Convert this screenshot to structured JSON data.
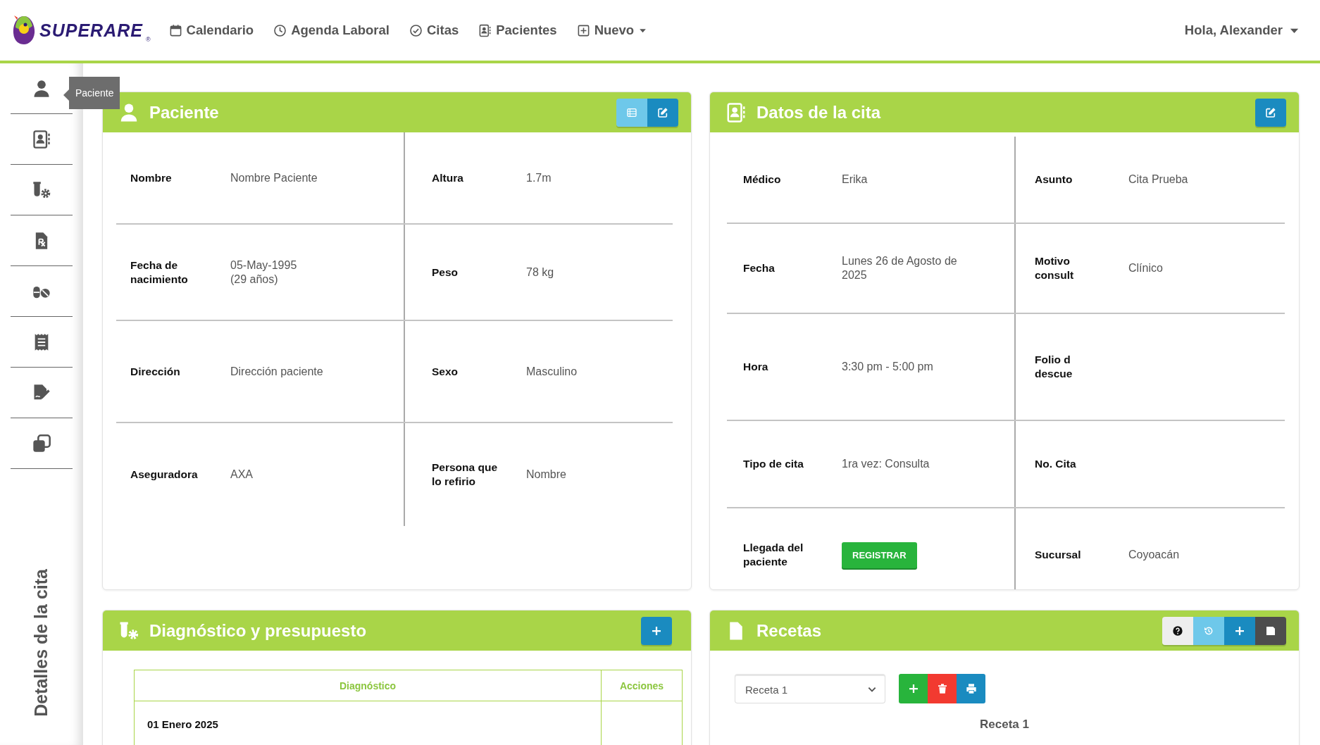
{
  "topbar": {
    "brand": "SUPERARE",
    "brand_mark": "®",
    "nav": [
      {
        "label": "Calendario",
        "dropdown": false
      },
      {
        "label": "Agenda Laboral",
        "dropdown": false
      },
      {
        "label": "Citas",
        "dropdown": false
      },
      {
        "label": "Pacientes",
        "dropdown": false
      },
      {
        "label": "Nuevo",
        "dropdown": true
      }
    ],
    "user": "Hola, Alexander"
  },
  "sidebar": {
    "tooltip": "Paciente",
    "title": "Detalles de la cita"
  },
  "patient": {
    "title": "Paciente",
    "rows": [
      {
        "cells": [
          {
            "label": "Nombre",
            "value": "Nombre Paciente"
          },
          {
            "label": "Altura",
            "value": "1.7m"
          }
        ]
      },
      {
        "cells": [
          {
            "label": "Fecha de\nnacimiento",
            "value": "05-May-1995\n(29 años)"
          },
          {
            "label": "Peso",
            "value": "78 kg"
          }
        ]
      },
      {
        "cells": [
          {
            "label": "Dirección",
            "value": "Dirección paciente"
          },
          {
            "label": "Sexo",
            "value": "Masculino"
          }
        ]
      },
      {
        "cells": [
          {
            "label": "Aseguradora",
            "value": "AXA"
          },
          {
            "label": "Persona que\nlo refirio",
            "value": "Nombre"
          }
        ]
      }
    ]
  },
  "appointment": {
    "title": "Datos de la cita",
    "rows": [
      {
        "cells": [
          {
            "label": "Médico",
            "value": "Erika"
          },
          {
            "label": "Asunto",
            "value": "Cita Prueba"
          }
        ]
      },
      {
        "cells": [
          {
            "label": "Fecha",
            "value": "Lunes 26 de Agosto de\n2025"
          },
          {
            "label": "Motivo\nconsult",
            "value": "Clínico"
          }
        ]
      },
      {
        "cells": [
          {
            "label": "Hora",
            "value": "3:30 pm - 5:00 pm"
          },
          {
            "label": "Folio d\ndescue"
          }
        ]
      },
      {
        "cells": [
          {
            "label": "Tipo de cita",
            "value": "1ra vez: Consulta"
          },
          {
            "label": "No. Cita"
          }
        ]
      },
      {
        "cells": [
          {
            "label": "Llegada del\npaciente",
            "action": "REGISTRAR"
          },
          {
            "label": "Sucursal",
            "value": "Coyoacán"
          }
        ]
      }
    ]
  },
  "diagnosis": {
    "title": "Diagnóstico y presupuesto",
    "columns": [
      "Diagnóstico",
      "Acciones"
    ],
    "rows": [
      {
        "date": "01 Enero 2025"
      }
    ]
  },
  "recipes": {
    "title": "Recetas",
    "select": "Receta 1",
    "heading": "Receta 1"
  }
}
